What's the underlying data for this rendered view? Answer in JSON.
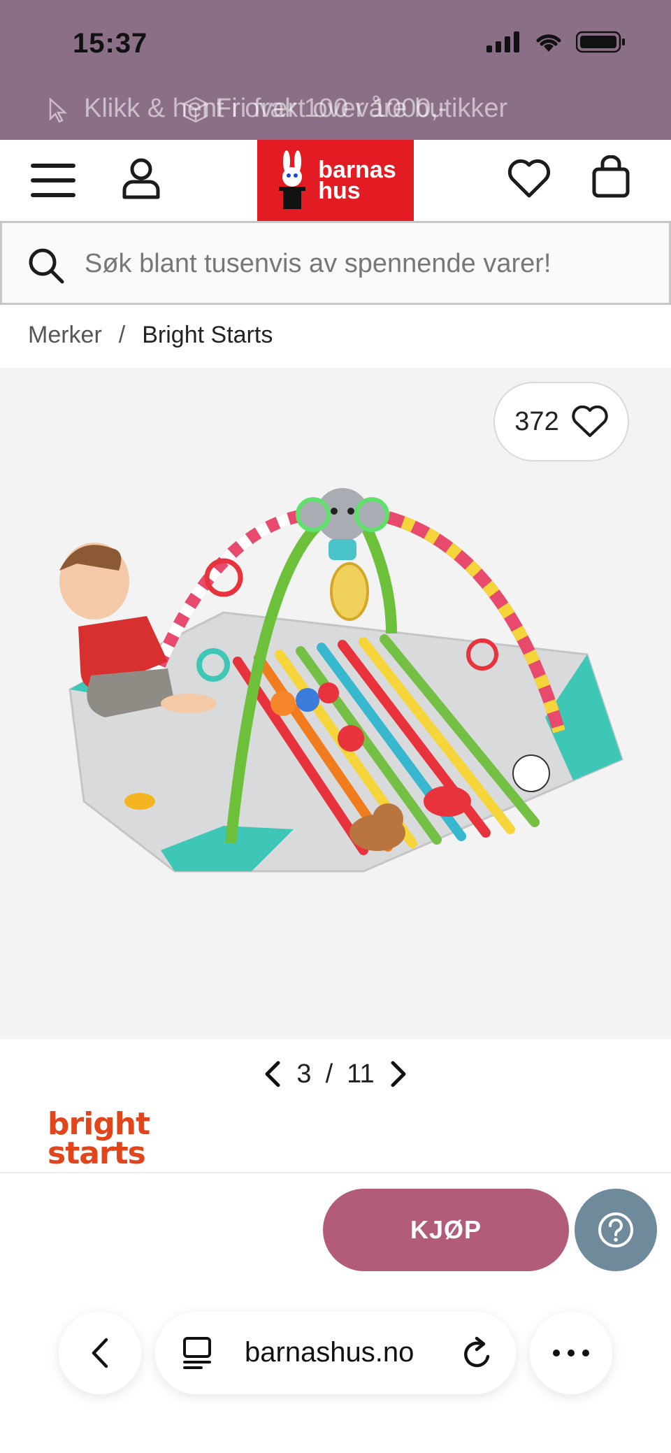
{
  "status_bar": {
    "time": "15:37",
    "icons": [
      "signal-icon",
      "wifi-icon",
      "battery-icon"
    ],
    "background": "#8a6f86"
  },
  "promo_bar": {
    "text_1": "Klikk & hent i over 100 våre butikker",
    "text_2": "Fri frakt over 1000,-"
  },
  "header": {
    "logo_line_1": "barnas",
    "logo_line_2": "hus",
    "logo_color": "#e31b23"
  },
  "search": {
    "placeholder": "Søk blant tusenvis av spennende varer!"
  },
  "breadcrumb": {
    "parent": "Merker",
    "separator": "/",
    "current": "Bright Starts"
  },
  "gallery": {
    "wishlist_count": "372",
    "current_page": "3",
    "separator": "/",
    "total_pages": "11"
  },
  "brand": {
    "line_1": "bright",
    "line_2": "starts",
    "color": "#e0451c"
  },
  "actions": {
    "buy_label": "KJØP",
    "buy_color": "#b35c79",
    "help_color": "#6f8a9a"
  },
  "browser": {
    "url": "barnashus.no"
  }
}
